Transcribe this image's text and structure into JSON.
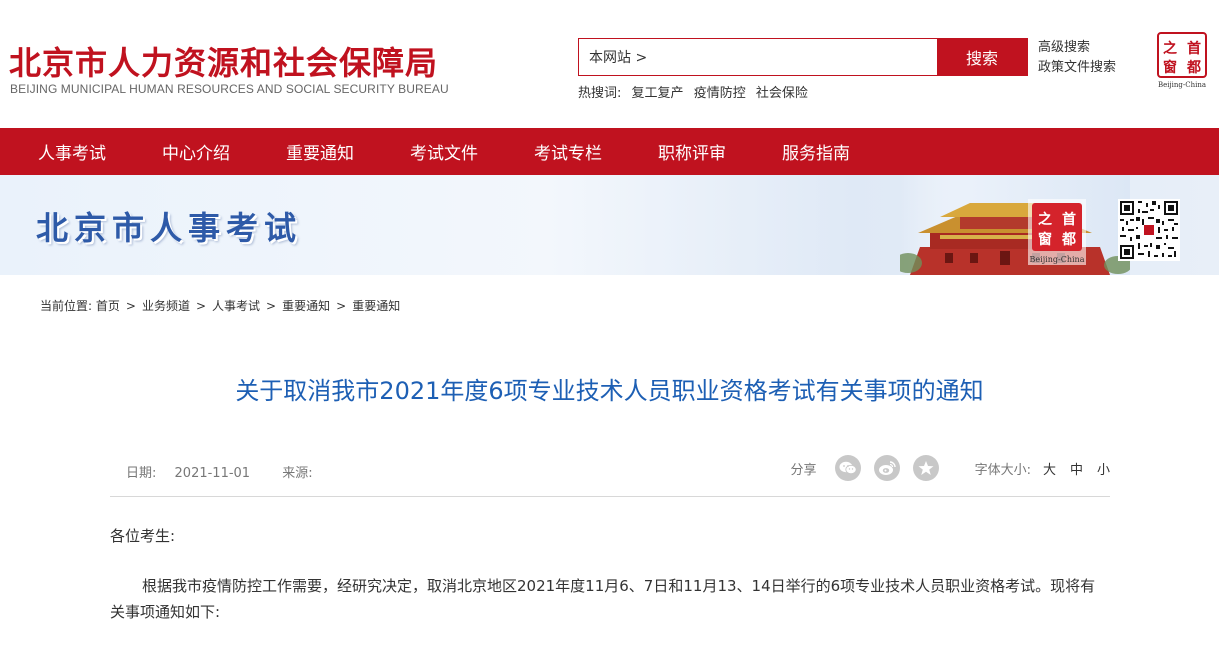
{
  "header": {
    "title": "北京市人力资源和社会保障局",
    "subtitle": "BEIJING MUNICIPAL HUMAN RESOURCES AND SOCIAL SECURITY BUREAU",
    "search": {
      "value": "本网站 >",
      "button_label": "搜索"
    },
    "advanced_search": "高级搜索",
    "policy_search": "政策文件搜索",
    "hot_label": "热搜词:",
    "hot_words": [
      "复工复产",
      "疫情防控",
      "社会保险"
    ],
    "seal_chars": [
      "之",
      "首",
      "窗",
      "都"
    ],
    "seal_caption": "Beijing-China"
  },
  "nav": {
    "items": [
      "人事考试",
      "中心介绍",
      "重要通知",
      "考试文件",
      "考试专栏",
      "职称评审",
      "服务指南"
    ]
  },
  "banner": {
    "title": "北京市人事考试",
    "seal_chars": [
      "之",
      "首",
      "窗",
      "都"
    ],
    "seal_caption": "Beijing-China"
  },
  "breadcrumb": {
    "label": "当前位置:",
    "items": [
      "首页",
      "业务频道",
      "人事考试",
      "重要通知",
      "重要通知"
    ]
  },
  "article": {
    "title": "关于取消我市2021年度6项专业技术人员职业资格考试有关事项的通知",
    "date_label": "日期:",
    "date": "2021-11-01",
    "source_label": "来源:",
    "share_label": "分享",
    "share_icons": [
      "wechat-icon",
      "weibo-icon",
      "favorite-icon"
    ],
    "font_size_label": "字体大小:",
    "font_sizes": [
      "大",
      "中",
      "小"
    ],
    "greeting": "各位考生:",
    "paragraph": "根据我市疫情防控工作需要，经研究决定，取消北京地区2021年度11月6、7日和11月13、14日举行的6项专业技术人员职业资格考试。现将有关事项通知如下:"
  },
  "colors": {
    "brand_red": "#c0121f",
    "title_blue": "#1d5fb4",
    "banner_blue": "#2e5aa8"
  }
}
